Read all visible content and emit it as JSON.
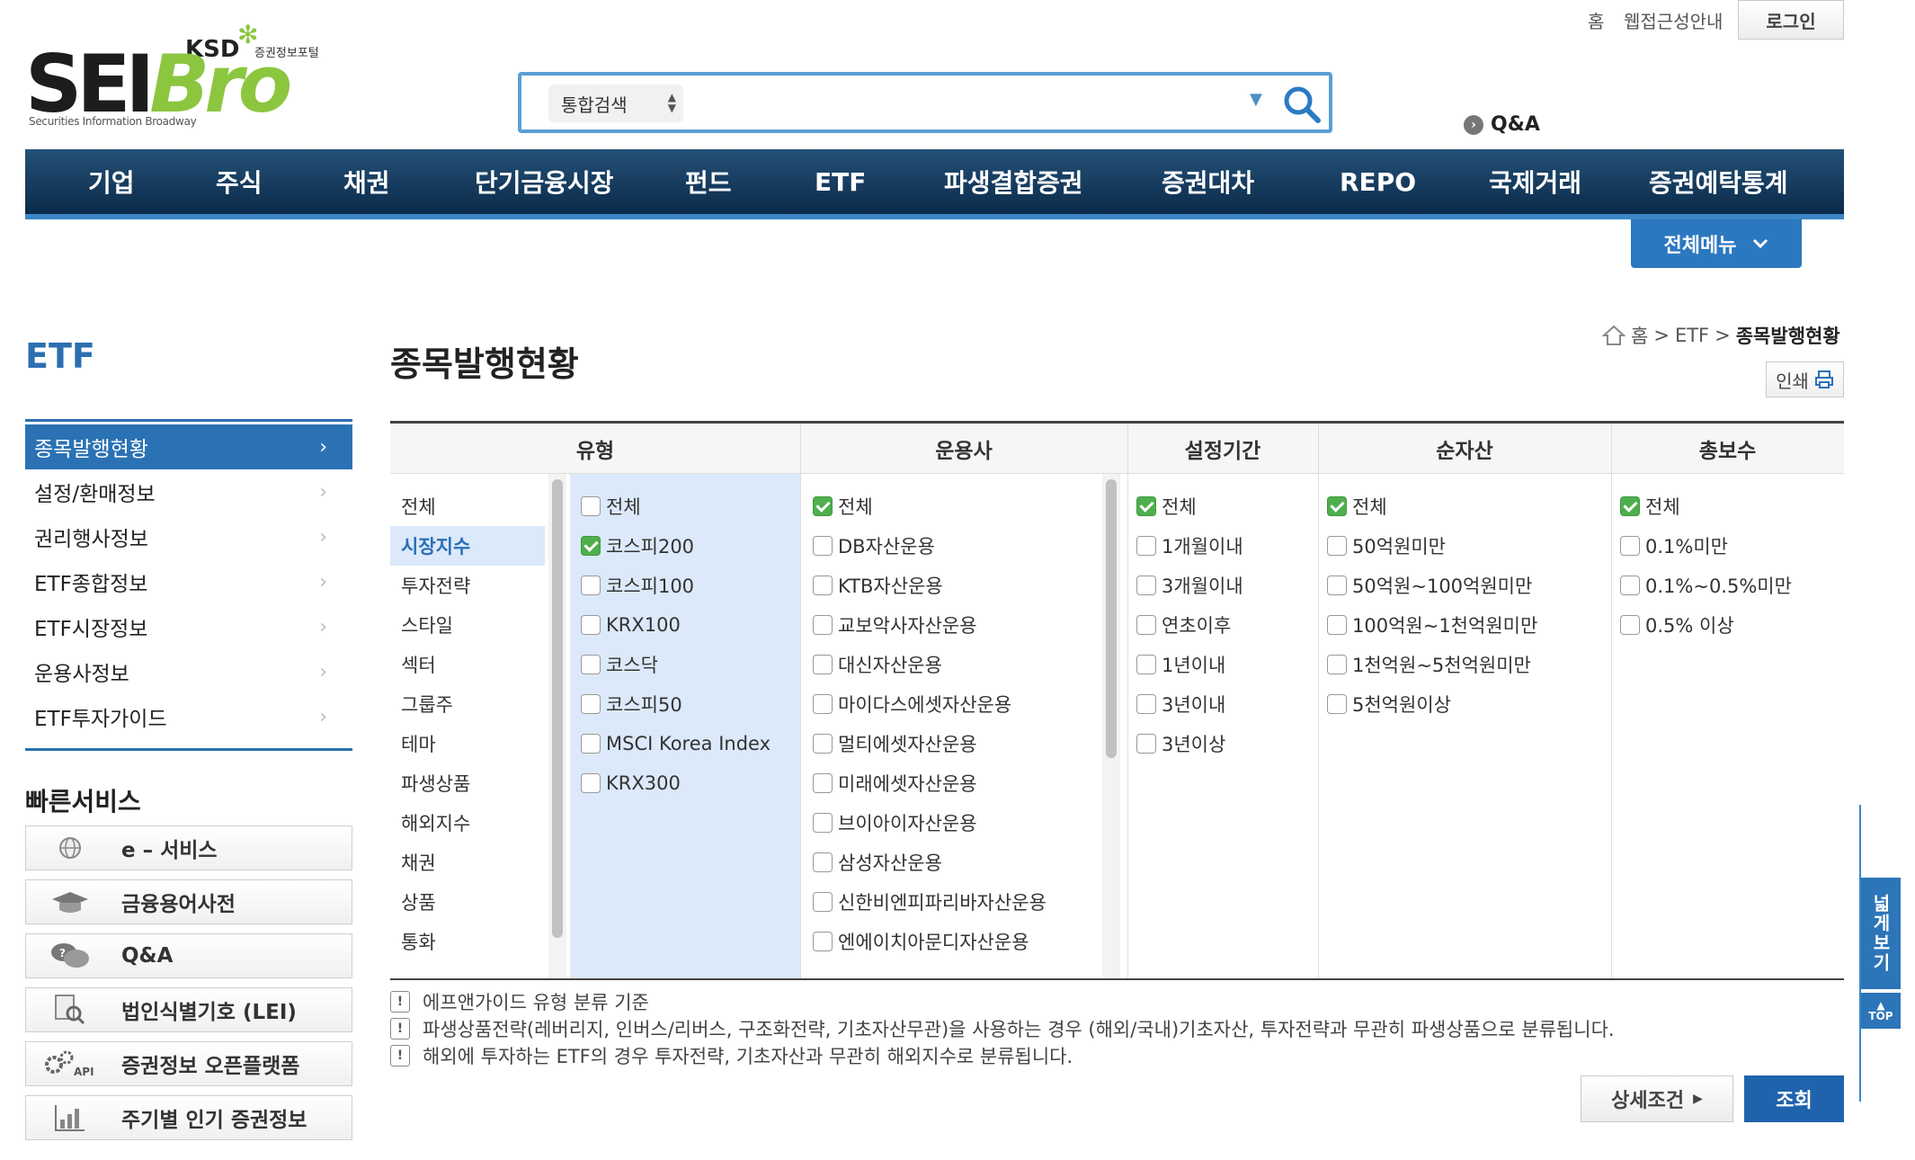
{
  "header": {
    "logo_main": "SEIBro",
    "logo_ksd": "KSD",
    "logo_portal": "증권정보포털",
    "logo_tagline": "Securities Information Broadway",
    "util_links": [
      "홈",
      "웹접근성안내"
    ],
    "login_label": "로그인",
    "search_scope": "통합검색",
    "search_placeholder": "",
    "qna_label": "Q&A"
  },
  "gnb": {
    "items": [
      "기업",
      "주식",
      "채권",
      "단기금융시장",
      "펀드",
      "ETF",
      "파생결합증권",
      "증권대차",
      "REPO",
      "국제거래",
      "증권예탁통계"
    ],
    "all_menu_label": "전체메뉴"
  },
  "lnb": {
    "title": "ETF",
    "items": [
      "종목발행현황",
      "설정/환매정보",
      "권리행사정보",
      "ETF종합정보",
      "ETF시장정보",
      "운용사정보",
      "ETF투자가이드"
    ],
    "active_index": 0,
    "quick_title": "빠른서비스",
    "quick_items": [
      {
        "label": "e – 서비스",
        "icon": "globe-icon"
      },
      {
        "label": "금융용어사전",
        "icon": "graduation-cap-icon"
      },
      {
        "label": "Q&A",
        "icon": "speech-bubbles-icon"
      },
      {
        "label": "법인식별기호 (LEI)",
        "icon": "document-search-icon"
      },
      {
        "label": "증권정보 오픈플랫폼",
        "icon": "api-gears-icon"
      },
      {
        "label": "주기별 인기 증권정보",
        "icon": "bar-chart-icon"
      }
    ]
  },
  "content": {
    "page_title": "종목발행현황",
    "breadcrumb": [
      "홈",
      "ETF",
      "종목발행현황"
    ],
    "print_label": "인쇄",
    "filter": {
      "headers": [
        "유형",
        "운용사",
        "설정기간",
        "순자산",
        "총보수"
      ],
      "types": [
        "전체",
        "시장지수",
        "투자전략",
        "스타일",
        "섹터",
        "그룹주",
        "테마",
        "파생상품",
        "해외지수",
        "채권",
        "상품",
        "통화"
      ],
      "selected_type_index": 1,
      "subtypes": [
        {
          "label": "전체",
          "checked": false
        },
        {
          "label": "코스피200",
          "checked": true
        },
        {
          "label": "코스피100",
          "checked": false
        },
        {
          "label": "KRX100",
          "checked": false
        },
        {
          "label": "코스닥",
          "checked": false
        },
        {
          "label": "코스피50",
          "checked": false
        },
        {
          "label": "MSCI Korea Index",
          "checked": false
        },
        {
          "label": "KRX300",
          "checked": false
        }
      ],
      "managers": [
        {
          "label": "전체",
          "checked": true
        },
        {
          "label": "DB자산운용",
          "checked": false
        },
        {
          "label": "KTB자산운용",
          "checked": false
        },
        {
          "label": "교보악사자산운용",
          "checked": false
        },
        {
          "label": "대신자산운용",
          "checked": false
        },
        {
          "label": "마이다스에셋자산운용",
          "checked": false
        },
        {
          "label": "멀티에셋자산운용",
          "checked": false
        },
        {
          "label": "미래에셋자산운용",
          "checked": false
        },
        {
          "label": "브이아이자산운용",
          "checked": false
        },
        {
          "label": "삼성자산운용",
          "checked": false
        },
        {
          "label": "신한비엔피파리바자산운용",
          "checked": false
        },
        {
          "label": "엔에이치아문디자산운용",
          "checked": false
        }
      ],
      "periods": [
        {
          "label": "전체",
          "checked": true
        },
        {
          "label": "1개월이내",
          "checked": false
        },
        {
          "label": "3개월이내",
          "checked": false
        },
        {
          "label": "연초이후",
          "checked": false
        },
        {
          "label": "1년이내",
          "checked": false
        },
        {
          "label": "3년이내",
          "checked": false
        },
        {
          "label": "3년이상",
          "checked": false
        }
      ],
      "assets": [
        {
          "label": "전체",
          "checked": true
        },
        {
          "label": "50억원미만",
          "checked": false
        },
        {
          "label": "50억원~100억원미만",
          "checked": false
        },
        {
          "label": "100억원~1천억원미만",
          "checked": false
        },
        {
          "label": "1천억원~5천억원미만",
          "checked": false
        },
        {
          "label": "5천억원이상",
          "checked": false
        }
      ],
      "fees": [
        {
          "label": "전체",
          "checked": true
        },
        {
          "label": "0.1%미만",
          "checked": false
        },
        {
          "label": "0.1%~0.5%미만",
          "checked": false
        },
        {
          "label": "0.5% 이상",
          "checked": false
        }
      ]
    },
    "notes": [
      "에프앤가이드 유형 분류 기준",
      "파생상품전략(레버리지, 인버스/리버스, 구조화전략, 기초자산무관)을 사용하는 경우 (해외/국내)기초자산, 투자전략과 무관히 파생상품으로 분류됩니다.",
      "해외에 투자하는 ETF의 경우 투자전략, 기초자산과 무관히 해외지수로 분류됩니다."
    ],
    "detail_label": "상세조건",
    "query_label": "조회"
  },
  "side": {
    "wide_view_label": "넓게보기",
    "top_label": "TOP"
  },
  "colors": {
    "nav_bg": "#0b2a49",
    "accent": "#2b72b4",
    "check_on": "#4fae4e",
    "logo_green": "#8cc63f"
  }
}
